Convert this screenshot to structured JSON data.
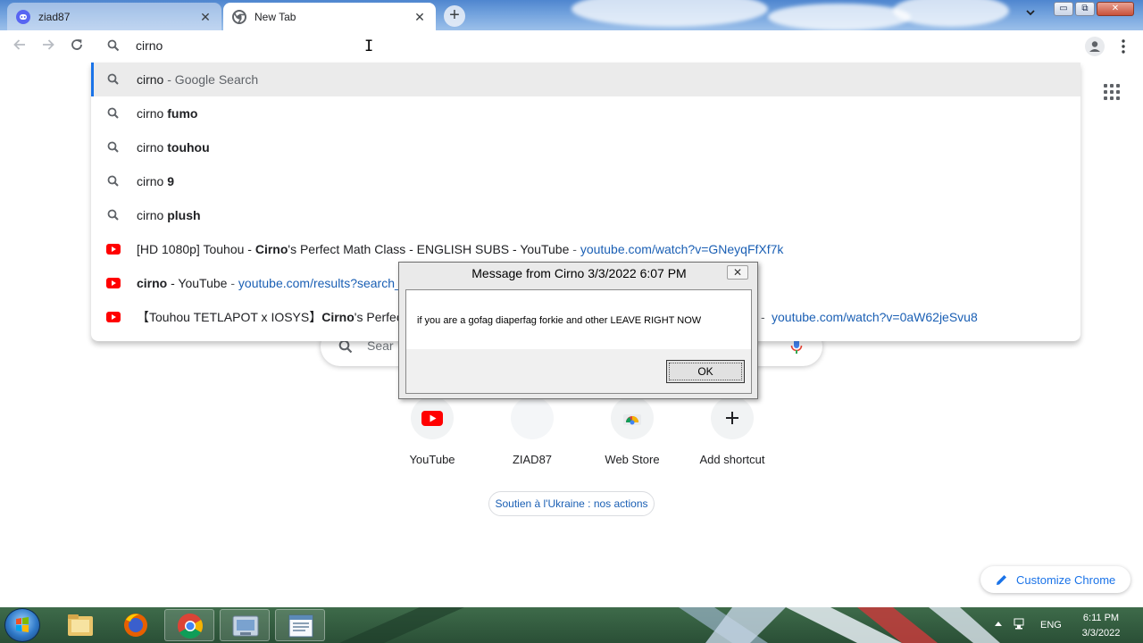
{
  "browser": {
    "tabs": [
      {
        "title": "ziad87",
        "icon": "discord-icon",
        "active": false
      },
      {
        "title": "New Tab",
        "icon": "chrome-icon",
        "active": true
      }
    ],
    "window_controls": {
      "minimize": "▭",
      "restore": "⧉",
      "close": "✕"
    }
  },
  "toolbar": {
    "omnibox_text": "cirno"
  },
  "suggestions": [
    {
      "type": "search",
      "plain": "cirno",
      "bold": "",
      "dim": " - Google Search",
      "url": "",
      "selected": true
    },
    {
      "type": "search",
      "plain": "cirno ",
      "bold": "fumo",
      "dim": "",
      "url": ""
    },
    {
      "type": "search",
      "plain": "cirno ",
      "bold": "touhou",
      "dim": "",
      "url": ""
    },
    {
      "type": "search",
      "plain": "cirno ",
      "bold": "9",
      "dim": "",
      "url": ""
    },
    {
      "type": "search",
      "plain": "cirno ",
      "bold": "plush",
      "dim": "",
      "url": ""
    },
    {
      "type": "youtube",
      "pre": "[HD 1080p] Touhou - ",
      "bold": "Cirno",
      "post": "'s Perfect Math Class - ENGLISH SUBS - YouTube",
      "dash": " - ",
      "url": "youtube.com/watch?v=GNeyqFfXf7k"
    },
    {
      "type": "youtube",
      "pre": "",
      "bold": "cirno",
      "post": " - YouTube",
      "dash": " - ",
      "url": "youtube.com/results?search_q"
    },
    {
      "type": "youtube",
      "pre": "【Touhou TETLAPOT x IOSYS】",
      "bold": "Cirno",
      "post": "'s Perfect Ma",
      "dash": "- ",
      "url": "youtube.com/watch?v=0aW62jeSvu8"
    }
  ],
  "ntp": {
    "search_placeholder": "Sear",
    "shortcuts": [
      {
        "label": "YouTube",
        "icon": "youtube-icon"
      },
      {
        "label": "ZIAD87",
        "icon": "blank-site-icon"
      },
      {
        "label": "Web Store",
        "icon": "webstore-icon"
      },
      {
        "label": "Add shortcut",
        "icon": "plus-icon"
      }
    ],
    "ukraine_link": "Soutien à l'Ukraine : nos actions",
    "customize_label": "Customize Chrome"
  },
  "dialog": {
    "title": "Message from Cirno 3/3/2022 6:07 PM",
    "message": "if you are a gofag diaperfag forkie and other LEAVE RIGHT NOW",
    "ok_label": "OK",
    "close_glyph": "✕"
  },
  "taskbar": {
    "apps": [
      "file-explorer-icon",
      "firefox-icon",
      "chrome-icon",
      "control-panel-icon",
      "notepad-icon"
    ],
    "language": "ENG",
    "time": "6:11 PM",
    "date": "3/3/2022"
  },
  "colors": {
    "accent_blue": "#1a73e8",
    "link_blue": "#1a5fb4",
    "youtube_red": "#ff0000"
  }
}
